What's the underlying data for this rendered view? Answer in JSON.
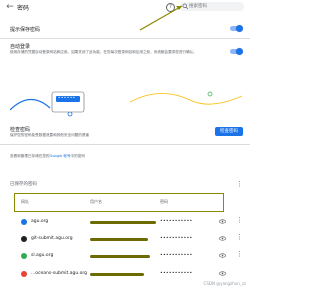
{
  "header": {
    "back_icon": "arrow-left-icon",
    "title": "密码",
    "help_icon": "help-circle-icon",
    "search": {
      "placeholder": "搜索密码",
      "icon": "search-icon"
    }
  },
  "settings": {
    "offer_save": {
      "label": "提示保存密码",
      "enabled": true
    },
    "auto_signin": {
      "label": "自动登录",
      "description": "使用存储的凭据自动登录网站和应用。如果关闭了此功能，在您每次登录网站和应用之前，系统都会要求您进行确认。",
      "enabled": true
    }
  },
  "checkup": {
    "title": "检查密码",
    "description": "保护您的密码免受数据泄露和其他安全问题的侵害",
    "button_label": "检查密码",
    "dots": "••••••"
  },
  "manage": {
    "prefix": "查看和管理已存储在您的",
    "link": "Google 帐号",
    "suffix": "中的密码"
  },
  "saved": {
    "title": "已保存的密码",
    "columns": {
      "site": "网址",
      "username": "用户名",
      "password": "密码"
    },
    "rows": [
      {
        "site": "agu.org",
        "password": "•••••••••••"
      },
      {
        "site": "git-submit.agu.org",
        "password": "•••••••••••"
      },
      {
        "site": "sl.agu.org",
        "password": "•••••••••••"
      },
      {
        "site": "...oceans-submit.agu.org",
        "password": "•••••••••••"
      }
    ]
  },
  "footer": {
    "watermark": "CSDN @yangzhun_sz"
  },
  "colors": {
    "accent": "#1a73e8",
    "toggle_track": "#8ab4f8",
    "annotation": "#8a8a00"
  }
}
